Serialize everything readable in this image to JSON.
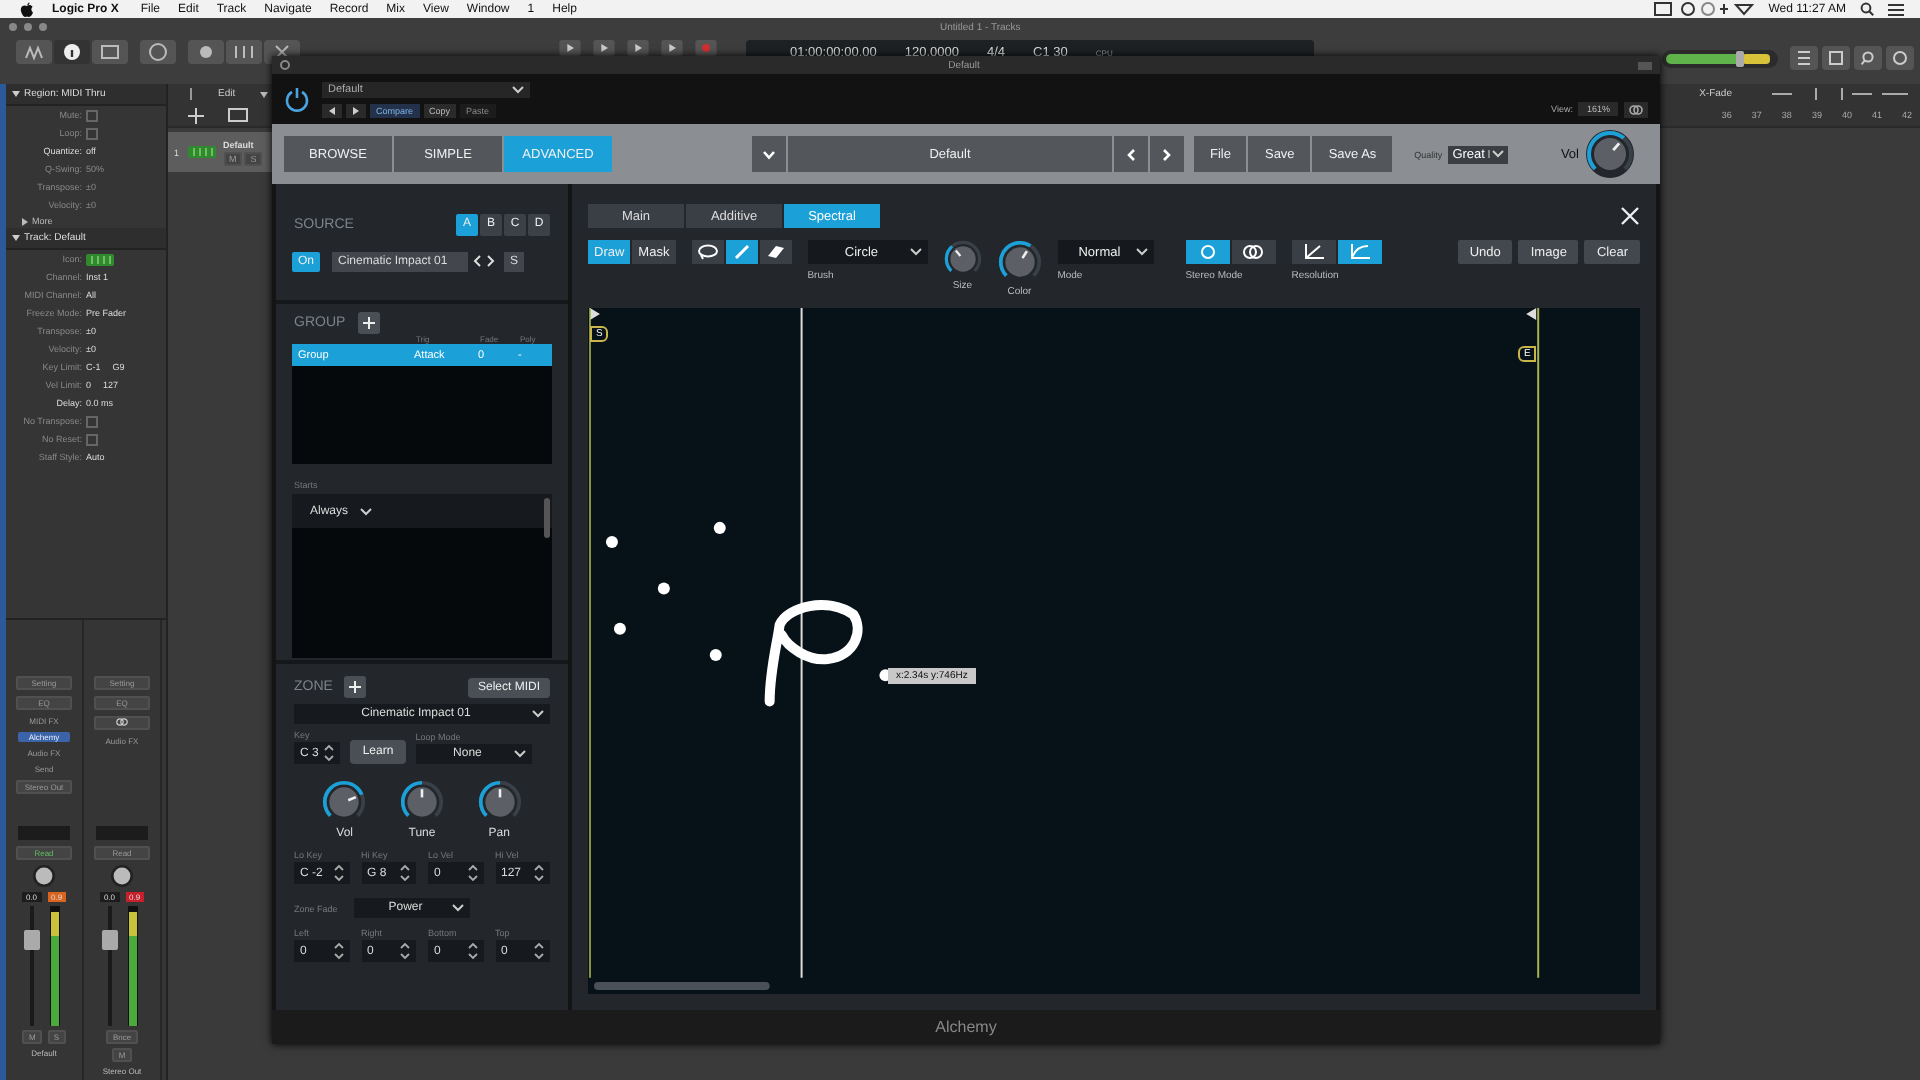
{
  "menu_bar": {
    "app": "Logic Pro X",
    "menus": [
      "File",
      "Edit",
      "Track",
      "Navigate",
      "Record",
      "Mix",
      "View",
      "Window",
      "1",
      "Help"
    ],
    "clock": "Wed 11:27 AM"
  },
  "window": {
    "title": "Untitled 1 - Tracks"
  },
  "lcd": {
    "position": "01:00:00:00.00",
    "tempo": "120.0000",
    "signature": "4/4",
    "key": "C1 30",
    "cpu_label": "CPU"
  },
  "inspector": {
    "region_title": "Region: MIDI Thru",
    "region_params": [
      {
        "label": "Mute:",
        "kind": "checkbox",
        "checked": false,
        "dimmed": true
      },
      {
        "label": "Loop:",
        "kind": "checkbox",
        "checked": false,
        "dimmed": true
      },
      {
        "label": "Quantize:",
        "kind": "value",
        "values": [
          "off"
        ],
        "dimmed": false
      },
      {
        "label": "Q-Swing:",
        "kind": "value",
        "values": [
          "50%"
        ],
        "dimmed": true
      },
      {
        "label": "Transpose:",
        "kind": "value",
        "values": [
          "±0"
        ],
        "dimmed": true
      },
      {
        "label": "Velocity:",
        "kind": "value",
        "values": [
          "±0"
        ],
        "dimmed": true
      }
    ],
    "more": "More",
    "track_title": "Track: Default",
    "track_params": [
      {
        "label": "Icon:",
        "kind": "icon",
        "dimmed": true
      },
      {
        "label": "Channel:",
        "kind": "value",
        "values": [
          "Inst 1"
        ],
        "dimmed": true
      },
      {
        "label": "MIDI Channel:",
        "kind": "value",
        "values": [
          "All"
        ],
        "dimmed": true
      },
      {
        "label": "Freeze Mode:",
        "kind": "value",
        "values": [
          "Pre Fader"
        ],
        "dimmed": true
      },
      {
        "label": "Transpose:",
        "kind": "value",
        "values": [
          "±0"
        ],
        "dimmed": true
      },
      {
        "label": "Velocity:",
        "kind": "value",
        "values": [
          "±0"
        ],
        "dimmed": true
      },
      {
        "label": "Key Limit:",
        "kind": "value",
        "values": [
          "C-1",
          "G9"
        ],
        "dimmed": true
      },
      {
        "label": "Vel Limit:",
        "kind": "value",
        "values": [
          "0",
          "127"
        ],
        "dimmed": true
      },
      {
        "label": "Delay:",
        "kind": "value",
        "values": [
          "0.0 ms"
        ],
        "dimmed": false
      },
      {
        "label": "No Transpose:",
        "kind": "checkbox",
        "checked": false,
        "dimmed": true
      },
      {
        "label": "No Reset:",
        "kind": "checkbox",
        "checked": false,
        "dimmed": true
      },
      {
        "label": "Staff Style:",
        "kind": "value",
        "values": [
          "Auto"
        ],
        "dimmed": true
      }
    ]
  },
  "channel_strips": [
    {
      "slots": [
        {
          "kind": "button",
          "text": "Setting"
        },
        {
          "kind": "button",
          "text": "EQ"
        },
        {
          "kind": "label",
          "text": "MIDI FX"
        },
        {
          "kind": "plugin",
          "text": "Alchemy"
        },
        {
          "kind": "label",
          "text": "Audio FX"
        },
        {
          "kind": "label",
          "text": "Send"
        },
        {
          "kind": "button",
          "text": "Stereo Out"
        }
      ],
      "automation": "Read",
      "automation_active": true,
      "volume": "0.0",
      "peak": "0.9",
      "color": "#d9641e",
      "level": 0.72,
      "buttons": [
        "M",
        "S"
      ],
      "name": "Default"
    },
    {
      "slots": [
        {
          "kind": "button",
          "text": "Setting"
        },
        {
          "kind": "button",
          "text": "EQ"
        },
        {
          "kind": "link"
        },
        {
          "kind": "label",
          "text": "Audio FX"
        }
      ],
      "automation": "Read",
      "automation_active": false,
      "volume": "0.0",
      "peak": "0.9",
      "color": "#c8202a",
      "level": 0.72,
      "extra": "Bnce",
      "buttons": [
        "M"
      ],
      "name": "Stereo Out"
    }
  ],
  "tracks": {
    "menu": "Edit",
    "rows": [
      {
        "number": "1",
        "name": "Default",
        "buttons": [
          "M",
          "S"
        ]
      }
    ],
    "xfade": "X-Fade",
    "ruler": [
      "36",
      "37",
      "38",
      "39",
      "40",
      "41",
      "42"
    ]
  },
  "plugin": {
    "title": "Default",
    "preset": "Default",
    "compare_buttons": [
      {
        "label": "Compare",
        "selected": true,
        "disabled": false
      },
      {
        "label": "Copy",
        "selected": false,
        "disabled": false
      },
      {
        "label": "Paste",
        "selected": false,
        "disabled": true
      }
    ],
    "view_label": "View:",
    "view": "161%",
    "footer": "Alchemy"
  },
  "alchemy": {
    "modes": [
      {
        "label": "BROWSE",
        "selected": false
      },
      {
        "label": "SIMPLE",
        "selected": false
      },
      {
        "label": "ADVANCED",
        "selected": true
      }
    ],
    "preset": "Default",
    "file_buttons": [
      "File",
      "Save",
      "Save As"
    ],
    "quality_label": "Quality",
    "quality": "Great",
    "vol_label": "Vol",
    "vol_knob": {
      "level": 0.65
    },
    "source": {
      "title": "SOURCE",
      "letters": [
        {
          "label": "A",
          "selected": true
        },
        {
          "label": "B",
          "selected": false
        },
        {
          "label": "C",
          "selected": false
        },
        {
          "label": "D",
          "selected": false
        }
      ],
      "on_label": "On",
      "on": true,
      "name": "Cinematic Impact 01",
      "solo": "S"
    },
    "group": {
      "title": "GROUP",
      "columns": [
        "",
        "Trig",
        "Fade",
        "Poly"
      ],
      "rows": [
        {
          "cells": [
            "Group",
            "Attack",
            "0",
            "-"
          ],
          "selected": true
        }
      ],
      "starts_label": "Starts",
      "starts": "Always"
    },
    "zone": {
      "title": "ZONE",
      "select_midi": "Select MIDI",
      "sample": "Cinematic Impact 01",
      "key_label": "Key",
      "key": "C 3",
      "learn": "Learn",
      "loop_mode_label": "Loop Mode",
      "loop_mode": "None",
      "knobs": [
        {
          "label": "Vol",
          "level": 0.75
        },
        {
          "label": "Tune",
          "level": 0.5
        },
        {
          "label": "Pan",
          "level": 0.5
        }
      ],
      "ranges": [
        {
          "label": "Lo Key",
          "value": "C -2"
        },
        {
          "label": "Hi Key",
          "value": "G 8"
        },
        {
          "label": "Lo Vel",
          "value": "0"
        },
        {
          "label": "Hi Vel",
          "value": "127"
        }
      ],
      "zone_fade_label": "Zone Fade",
      "zone_fade": "Power",
      "fades": [
        {
          "label": "Left",
          "value": "0"
        },
        {
          "label": "Right",
          "value": "0"
        },
        {
          "label": "Bottom",
          "value": "0"
        },
        {
          "label": "Top",
          "value": "0"
        }
      ]
    },
    "editor": {
      "tabs": [
        {
          "label": "Main",
          "selected": false
        },
        {
          "label": "Additive",
          "selected": false
        },
        {
          "label": "Spectral",
          "selected": true
        }
      ],
      "modes": [
        {
          "label": "Draw",
          "selected": true
        },
        {
          "label": "Mask",
          "selected": false
        }
      ],
      "tools": [
        {
          "kind": "lasso",
          "selected": false
        },
        {
          "kind": "pen",
          "selected": true
        },
        {
          "kind": "eraser",
          "selected": false
        }
      ],
      "brush": "Circle",
      "brush_label": "Brush",
      "size_label": "Size",
      "size_knob": {
        "level": 0.35
      },
      "color_label": "Color",
      "color_knob": {
        "level": 0.62
      },
      "mode": "Normal",
      "mode_label": "Mode",
      "stereo_modes": [
        {
          "kind": "single",
          "selected": true
        },
        {
          "kind": "double",
          "selected": false
        }
      ],
      "stereo_label": "Stereo Mode",
      "resolutions": [
        {
          "kind": "low",
          "selected": false
        },
        {
          "kind": "high",
          "selected": true
        }
      ],
      "resolution_label": "Resolution",
      "actions": [
        "Undo",
        "Image",
        "Clear"
      ],
      "start_marker": "S",
      "end_marker": "E",
      "tooltip": "x:2.34s y:746Hz"
    }
  }
}
